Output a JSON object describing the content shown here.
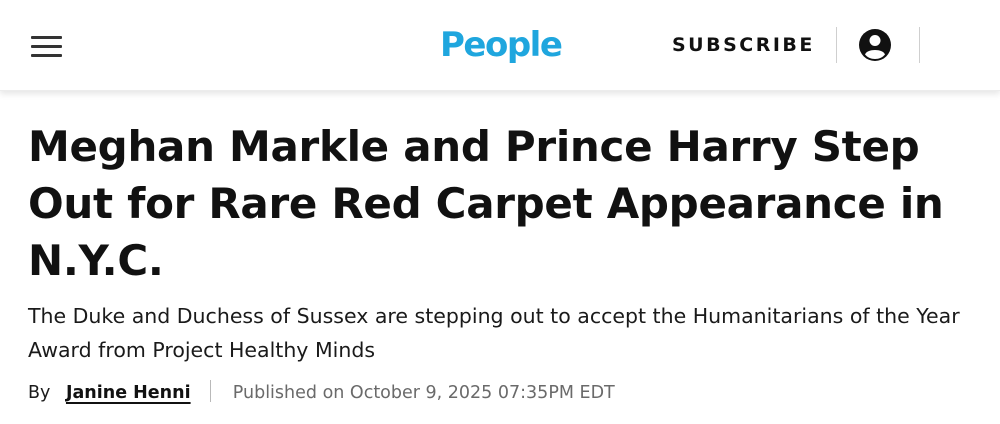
{
  "header": {
    "logo_text": "People",
    "subscribe_label": "SUBSCRIBE",
    "menu_icon": "hamburger-menu-icon",
    "account_icon": "user-account-icon"
  },
  "article": {
    "headline": "Meghan Markle and Prince Harry Step Out for Rare Red Carpet Appearance in N.Y.C.",
    "dek": "The Duke and Duchess of Sussex are stepping out to accept the Humanitarians of the Year Award from Project Healthy Minds",
    "byline": {
      "prefix": "By",
      "author": "Janine Henni",
      "published": "Published on October 9, 2025 07:35PM EDT"
    }
  },
  "colors": {
    "brand": "#1fa6de",
    "text": "#111111",
    "muted": "#6a6a6a"
  }
}
